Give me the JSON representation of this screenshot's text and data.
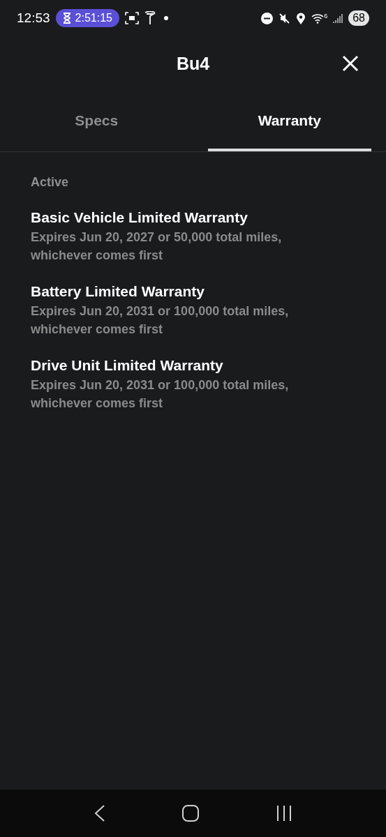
{
  "status_bar": {
    "time": "12:53",
    "timer": "2:51:15",
    "wifi_band": "6",
    "battery": "68"
  },
  "header": {
    "title": "Bu4"
  },
  "tabs": [
    {
      "label": "Specs",
      "selected": false
    },
    {
      "label": "Warranty",
      "selected": true
    }
  ],
  "section": {
    "heading": "Active",
    "items": [
      {
        "title": "Basic Vehicle Limited Warranty",
        "detail": "Expires Jun 20, 2027 or 50,000 total miles, whichever comes first"
      },
      {
        "title": "Battery Limited Warranty",
        "detail": "Expires Jun 20, 2031 or 100,000 total miles, whichever comes first"
      },
      {
        "title": "Drive Unit Limited Warranty",
        "detail": "Expires Jun 20, 2031 or 100,000 total miles, whichever comes first"
      }
    ]
  }
}
